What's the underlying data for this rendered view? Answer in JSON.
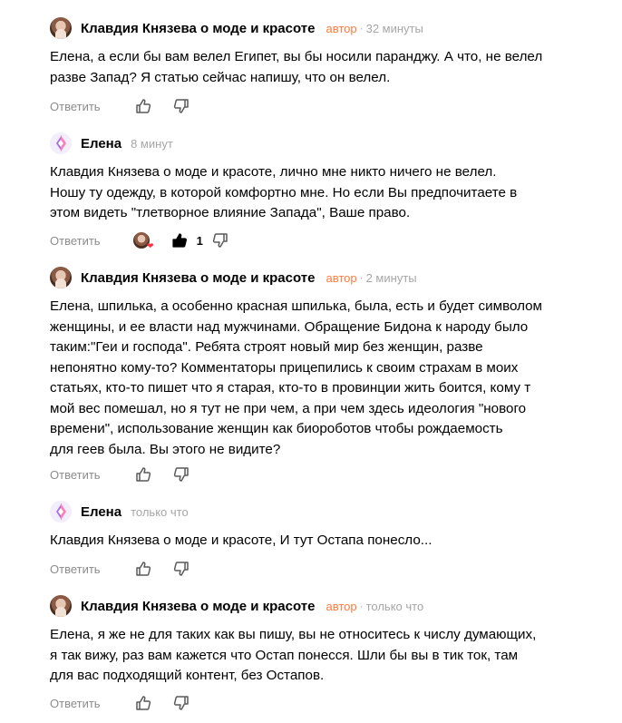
{
  "comments": [
    {
      "author": "Клавдия Князева о моде и красоте",
      "badge": "автор",
      "dot": "·",
      "time": "32 минуты",
      "lines": [
        "Елена, а если бы вам велел Египет, вы бы носили паранджу. А что, не велел",
        "разве Запад? Я статью сейчас напишу, что он велел."
      ],
      "reply_label": "Ответить"
    },
    {
      "author": "Елена",
      "time": "8 минут",
      "lines": [
        "Клавдия Князева о моде и красоте, лично мне никто ничего не велел.",
        "Ношу ту одежду, в которой комфортно мне. Но если Вы предпочитаете в",
        "этом видеть \"тлетворное влияние Запада\", Ваше право."
      ],
      "reply_label": "Ответить",
      "like_count": "1"
    },
    {
      "author": "Клавдия Князева о моде и красоте",
      "badge": "автор",
      "dot": "·",
      "time": "2 минуты",
      "lines": [
        "Елена, шпилька, а особенно красная шпилька, была, есть и будет символом",
        "женщины, и ее власти над мужчинами. Обращение Бидона к народу было",
        "таким:\"Геи и господа\". Ребята строят новый мир без женщин, разве",
        "непонятно кому-то? Комментаторы прицепились к своим страхам в моих",
        "статьях, кто-то пишет что я старая, кто-то в провинции жить боится, кому т",
        "мой вес помешал, но я тут не при чем, а при чем здесь идеология \"нового",
        "времени\", использование женщин как биороботов чтобы рождаемость",
        "для геев была. Вы этого не видите?"
      ],
      "reply_label": "Ответить"
    },
    {
      "author": "Елена",
      "time": "только что",
      "lines": [
        "Клавдия Князева о моде и красоте, И тут Остапа понесло..."
      ],
      "reply_label": "Ответить"
    },
    {
      "author": "Клавдия Князева о моде и красоте",
      "badge": "автор",
      "dot": "·",
      "time": "только что",
      "lines": [
        "Елена, я же не для таких как вы пишу, вы не относитесь к числу думающих,",
        "я так вижу, раз вам кажется что Остап понесся. Шли бы вы в тик ток, там",
        "для вас подходящий контент, без Остапов."
      ],
      "reply_label": "Ответить"
    }
  ],
  "colors": {
    "author_badge": "#ff7a3d",
    "meta_gray": "#a6a6a6",
    "reply_gray": "#8c8c8c",
    "heart": "#ff3347"
  },
  "icons": {
    "like": "thumb-up-icon",
    "dislike": "thumb-down-icon",
    "liked": "thumb-up-filled-icon",
    "reaction_heart": "heart-icon"
  }
}
